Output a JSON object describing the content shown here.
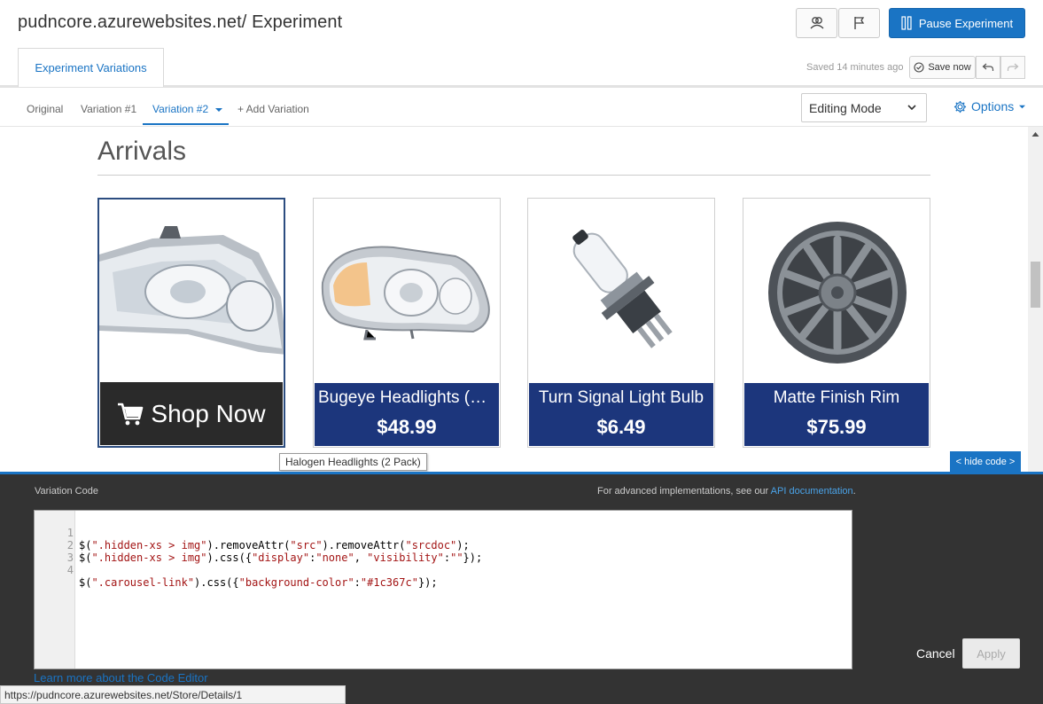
{
  "header": {
    "title": "pudncore.azurewebsites.net/ Experiment",
    "pause_label": "Pause Experiment"
  },
  "tabs": {
    "active_label": "Experiment Variations"
  },
  "save": {
    "status": "Saved 14 minutes ago",
    "save_now_label": "Save now"
  },
  "variations": {
    "items": [
      "Original",
      "Variation #1",
      "Variation #2",
      "+ Add Variation"
    ],
    "selected": "Variation #2"
  },
  "editing_mode": {
    "value": "Editing Mode"
  },
  "options_label": "Options",
  "page": {
    "section_title": "Arrivals",
    "products": [
      {
        "name": "Halogen Headlights (2 Pack)",
        "price": "",
        "button": "Shop Now"
      },
      {
        "name": "Bugeye Headlights (2 ...",
        "price": "$48.99"
      },
      {
        "name": "Turn Signal Light Bulb",
        "price": "$6.49"
      },
      {
        "name": "Matte Finish Rim",
        "price": "$75.99"
      }
    ],
    "tooltip": "Halogen Headlights (2 Pack)"
  },
  "code_panel": {
    "hide_code_label": "< hide code >",
    "label": "Variation Code",
    "advanced_prefix": "For advanced implementations, see our ",
    "advanced_link": "API documentation",
    "advanced_suffix": ".",
    "lines": [
      "$(\".hidden-xs > img\").removeAttr(\"src\").removeAttr(\"srcdoc\");",
      "$(\".hidden-xs > img\").css({\"display\":\"none\", \"visibility\":\"\"});",
      "",
      "$(\".carousel-link\").css({\"background-color\":\"#1c367c\"});"
    ],
    "learn_more": "Learn more about the Code Editor",
    "cancel_label": "Cancel",
    "apply_label": "Apply"
  },
  "status_bar": {
    "url": "https://pudncore.azurewebsites.net/Store/Details/1"
  },
  "colors": {
    "accent": "#1a74c4",
    "product_label_bg": "#1c367c",
    "code_panel_bg": "#333333"
  }
}
